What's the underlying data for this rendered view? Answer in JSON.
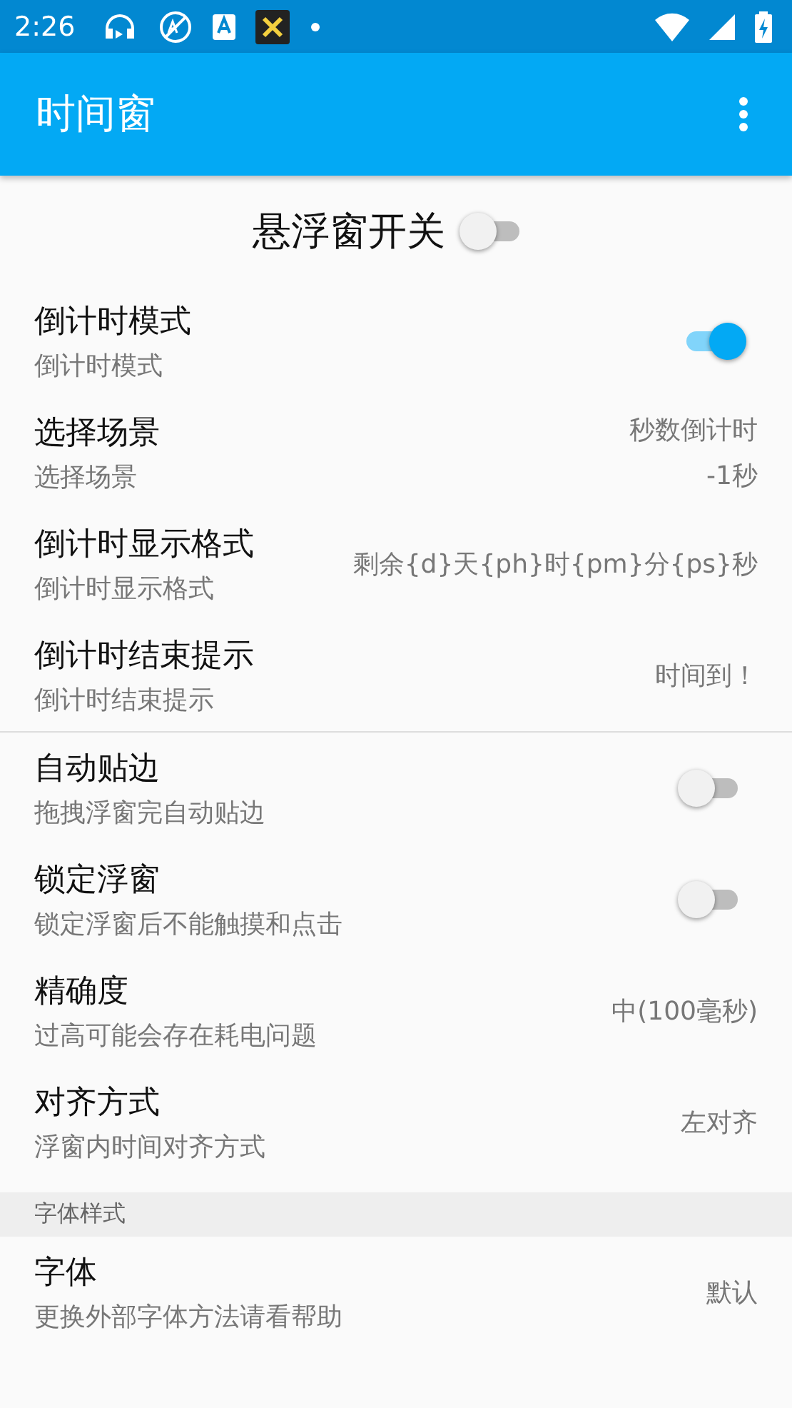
{
  "status_bar": {
    "time": "2:26"
  },
  "app_bar": {
    "title": "时间窗"
  },
  "master_switch": {
    "label": "悬浮窗开关",
    "on": false
  },
  "sections": [
    {
      "items": [
        {
          "kind": "switch",
          "title": "倒计时模式",
          "summary": "倒计时模式",
          "on": true
        },
        {
          "kind": "value",
          "title": "选择场景",
          "summary": "选择场景",
          "value": [
            "秒数倒计时",
            "-1秒"
          ]
        },
        {
          "kind": "value",
          "title": "倒计时显示格式",
          "summary": "倒计时显示格式",
          "value": [
            "剩余{d}天{ph}时{pm}分{ps}秒"
          ]
        },
        {
          "kind": "value",
          "title": "倒计时结束提示",
          "summary": "倒计时结束提示",
          "value": [
            "时间到！"
          ]
        }
      ]
    },
    {
      "items": [
        {
          "kind": "switch",
          "title": "自动贴边",
          "summary": "拖拽浮窗完自动贴边",
          "on": false
        },
        {
          "kind": "switch",
          "title": "锁定浮窗",
          "summary": "锁定浮窗后不能触摸和点击",
          "on": false
        },
        {
          "kind": "value",
          "title": "精确度",
          "summary": "过高可能会存在耗电问题",
          "value": [
            "中(100毫秒)"
          ]
        },
        {
          "kind": "value",
          "title": "对齐方式",
          "summary": "浮窗内时间对齐方式",
          "value": [
            "左对齐"
          ]
        }
      ]
    },
    {
      "header": "字体样式",
      "items": [
        {
          "kind": "value",
          "title": "字体",
          "summary": "更换外部字体方法请看帮助",
          "value": [
            "默认"
          ]
        }
      ]
    }
  ]
}
